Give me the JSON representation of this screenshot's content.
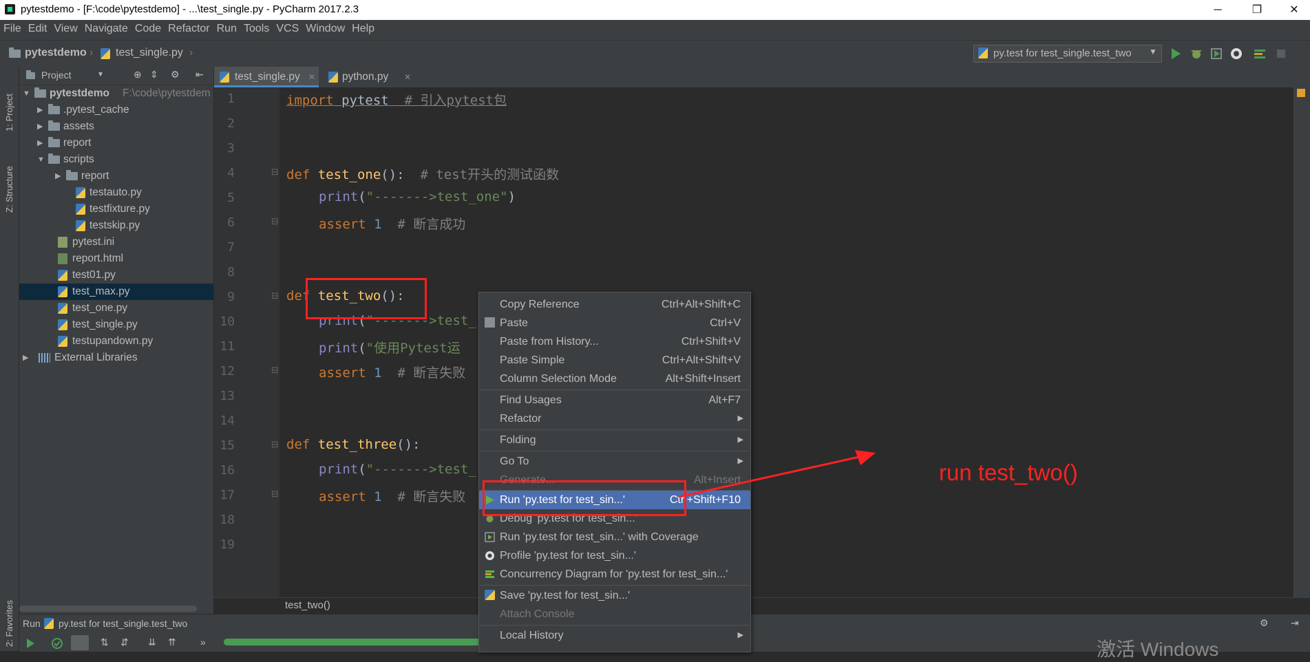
{
  "window": {
    "title": "pytestdemo - [F:\\code\\pytestdemo] - ...\\test_single.py - PyCharm 2017.2.3",
    "minimize": "─",
    "maximize": "❐",
    "close": "✕"
  },
  "menubar": [
    "File",
    "Edit",
    "View",
    "Navigate",
    "Code",
    "Refactor",
    "Run",
    "Tools",
    "VCS",
    "Window",
    "Help"
  ],
  "navbar": {
    "project": "pytestdemo",
    "file": "test_single.py",
    "run_config": "py.test for test_single.test_two"
  },
  "sidebar": {
    "project_tab": "1: Project",
    "structure_tab": "Z: Structure",
    "favorites_tab": "2: Favorites"
  },
  "project_panel": {
    "header": "Project",
    "root": {
      "name": "pytestdemo",
      "path": "F:\\code\\pytestdem"
    },
    "items": [
      {
        "label": "pytestdemo",
        "path": "F:\\code\\pytestdem"
      },
      {
        "label": ".pytest_cache"
      },
      {
        "label": "assets"
      },
      {
        "label": "report"
      },
      {
        "label": "scripts"
      },
      {
        "label": "report"
      },
      {
        "label": "testauto.py"
      },
      {
        "label": "testfixture.py"
      },
      {
        "label": "testskip.py"
      },
      {
        "label": "pytest.ini"
      },
      {
        "label": "report.html"
      },
      {
        "label": "test01.py"
      },
      {
        "label": "test_max.py"
      },
      {
        "label": "test_one.py"
      },
      {
        "label": "test_single.py"
      },
      {
        "label": "testupandown.py"
      },
      {
        "label": "External Libraries"
      }
    ]
  },
  "editor": {
    "tabs": [
      {
        "label": "test_single.py",
        "active": true
      },
      {
        "label": "python.py",
        "active": false
      }
    ],
    "line_numbers": [
      "1",
      "2",
      "3",
      "4",
      "5",
      "6",
      "7",
      "8",
      "9",
      "10",
      "11",
      "12",
      "13",
      "14",
      "15",
      "16",
      "17",
      "18",
      "19"
    ],
    "code": {
      "l1_kw": "import",
      "l1_mod": " pytest",
      "l1_cm": "  # 引入pytest包",
      "l4_kw": "def",
      "l4_fn": " test_one",
      "l4_p": "():",
      "l4_cm": "  # test开头的测试函数",
      "l5_bi": "print",
      "l5_p1": "(",
      "l5_str": "\"------->test_one\"",
      "l5_p2": ")",
      "l6_kw": "assert",
      "l6_num": " 1",
      "l6_cm": "  # 断言成功",
      "l9_kw": "def",
      "l9_fn": " test_two",
      "l9_p": "():",
      "l10_bi": "print",
      "l10_p1": "(",
      "l10_str": "\"------->test_",
      "l11_bi": "print",
      "l11_p1": "(",
      "l11_str": "\"使用Pytest运",
      "l12_kw": "assert",
      "l12_num": " 1",
      "l12_cm": "  # 断言失败",
      "l15_kw": "def",
      "l15_fn": " test_three",
      "l15_p": "():",
      "l16_bi": "print",
      "l16_p1": "(",
      "l16_str": "\"------->test_",
      "l17_kw": "assert",
      "l17_num": " 1",
      "l17_cm": "  # 断言失败"
    },
    "breadcrumb": "test_two()"
  },
  "context_menu": {
    "items": [
      {
        "label": "Copy Reference",
        "shortcut": "Ctrl+Alt+Shift+C"
      },
      {
        "label": "Paste",
        "shortcut": "Ctrl+V"
      },
      {
        "label": "Paste from History...",
        "shortcut": "Ctrl+Shift+V"
      },
      {
        "label": "Paste Simple",
        "shortcut": "Ctrl+Alt+Shift+V"
      },
      {
        "label": "Column Selection Mode",
        "shortcut": "Alt+Shift+Insert"
      },
      {
        "label": "Find Usages",
        "shortcut": "Alt+F7"
      },
      {
        "label": "Refactor",
        "shortcut": ""
      },
      {
        "label": "Folding",
        "shortcut": ""
      },
      {
        "label": "Go To",
        "shortcut": ""
      },
      {
        "label": "Generate...",
        "shortcut": "Alt+Insert"
      },
      {
        "label": "Run 'py.test for test_sin...'",
        "shortcut": "Ctrl+Shift+F10"
      },
      {
        "label": "Debug 'py.test for test_sin...'",
        "shortcut": ""
      },
      {
        "label": "Run 'py.test for test_sin...' with Coverage",
        "shortcut": ""
      },
      {
        "label": "Profile 'py.test for test_sin...'",
        "shortcut": ""
      },
      {
        "label": "Concurrency Diagram for  'py.test for test_sin...'",
        "shortcut": ""
      },
      {
        "label": "Save 'py.test for test_sin...'",
        "shortcut": ""
      },
      {
        "label": "Attach Console",
        "shortcut": ""
      },
      {
        "label": "Local History",
        "shortcut": ""
      }
    ],
    "submenu_arrow": "▶"
  },
  "run_panel": {
    "title": "Run",
    "config": "py.test for test_single.test_two"
  },
  "annotation": {
    "text": "run test_two()",
    "color": "#ff2222"
  },
  "watermark": "激活 Windows",
  "colors": {
    "keyword": "#cc7832",
    "function": "#ffc66d",
    "string": "#6a8759",
    "comment": "#808080",
    "selection": "#4b6eaf"
  }
}
